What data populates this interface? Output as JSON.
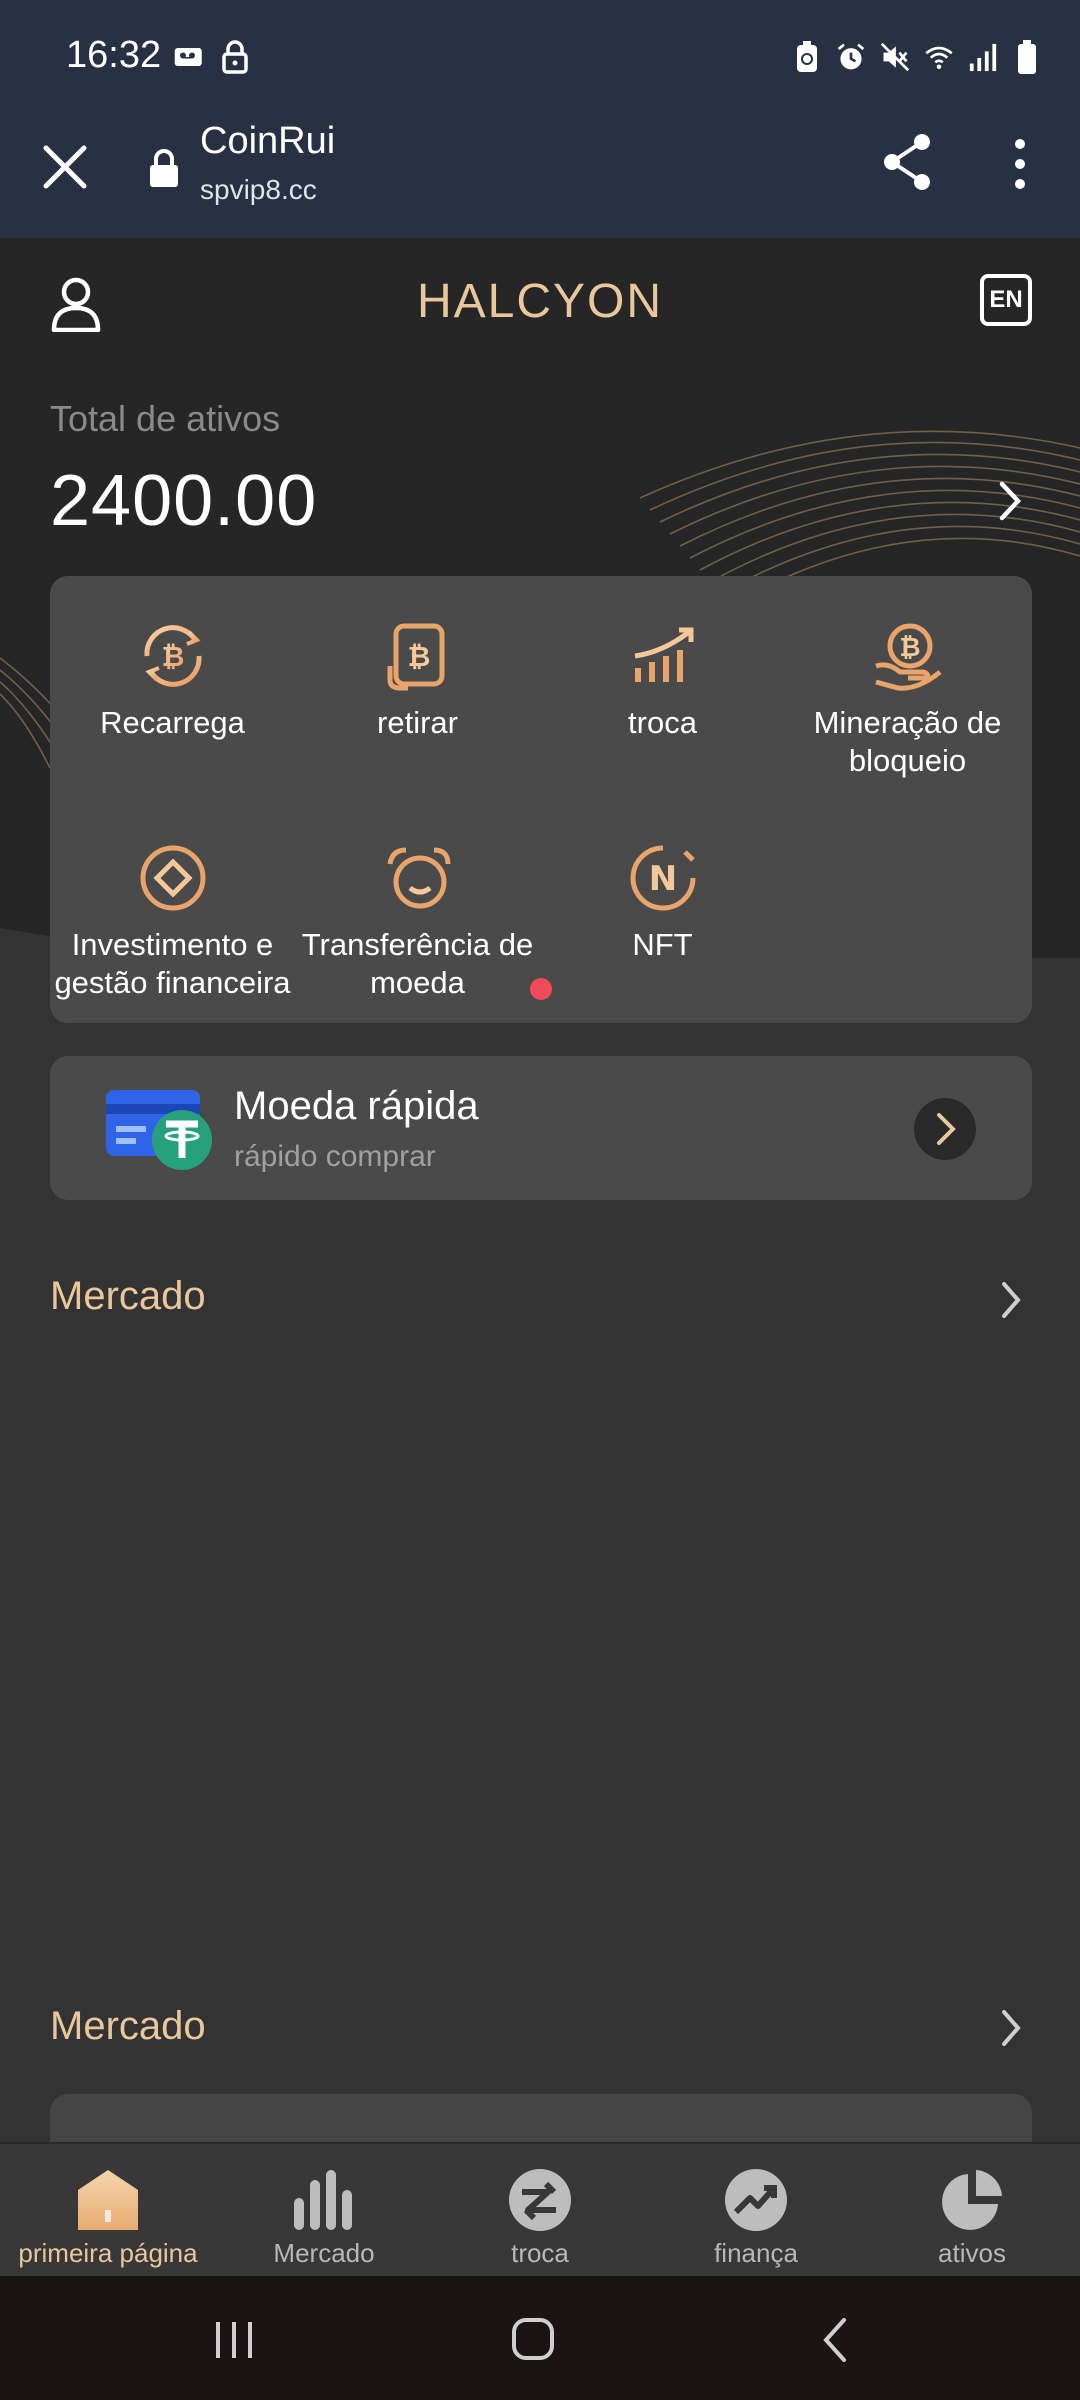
{
  "status_bar": {
    "time": "16:32"
  },
  "browser": {
    "title": "CoinRui",
    "url": "spvip8.cc"
  },
  "header": {
    "brand": "HALCYON",
    "lang": "EN"
  },
  "assets": {
    "label": "Total de ativos",
    "value": "2400.00"
  },
  "actions": [
    {
      "label": "Recarrega",
      "icon": "bitcoin-refresh-icon"
    },
    {
      "label": "retirar",
      "icon": "bitcoin-withdraw-icon"
    },
    {
      "label": "troca",
      "icon": "trade-chart-icon"
    },
    {
      "label": "Mineração de bloqueio",
      "icon": "bitcoin-hand-icon"
    },
    {
      "label": "Investimento e gestão financeira",
      "icon": "diamond-circle-icon"
    },
    {
      "label": "Transferência de moeda",
      "icon": "alarm-smile-icon"
    },
    {
      "label": "NFT",
      "icon": "nft-icon"
    }
  ],
  "quick": {
    "title": "Moeda rápida",
    "subtitle": "rápido comprar"
  },
  "sections": {
    "market1": "Mercado",
    "market2": "Mercado"
  },
  "bottom_nav": [
    {
      "label": "primeira página",
      "icon": "home-icon",
      "active": true
    },
    {
      "label": "Mercado",
      "icon": "bars-icon",
      "active": false
    },
    {
      "label": "troca",
      "icon": "exchange-icon",
      "active": false
    },
    {
      "label": "finança",
      "icon": "trend-icon",
      "active": false
    },
    {
      "label": "ativos",
      "icon": "pie-icon",
      "active": false
    }
  ],
  "colors": {
    "accent": "#e9c79c",
    "background": "#333333",
    "card": "#4a4a4a",
    "chrome": "#283043"
  }
}
